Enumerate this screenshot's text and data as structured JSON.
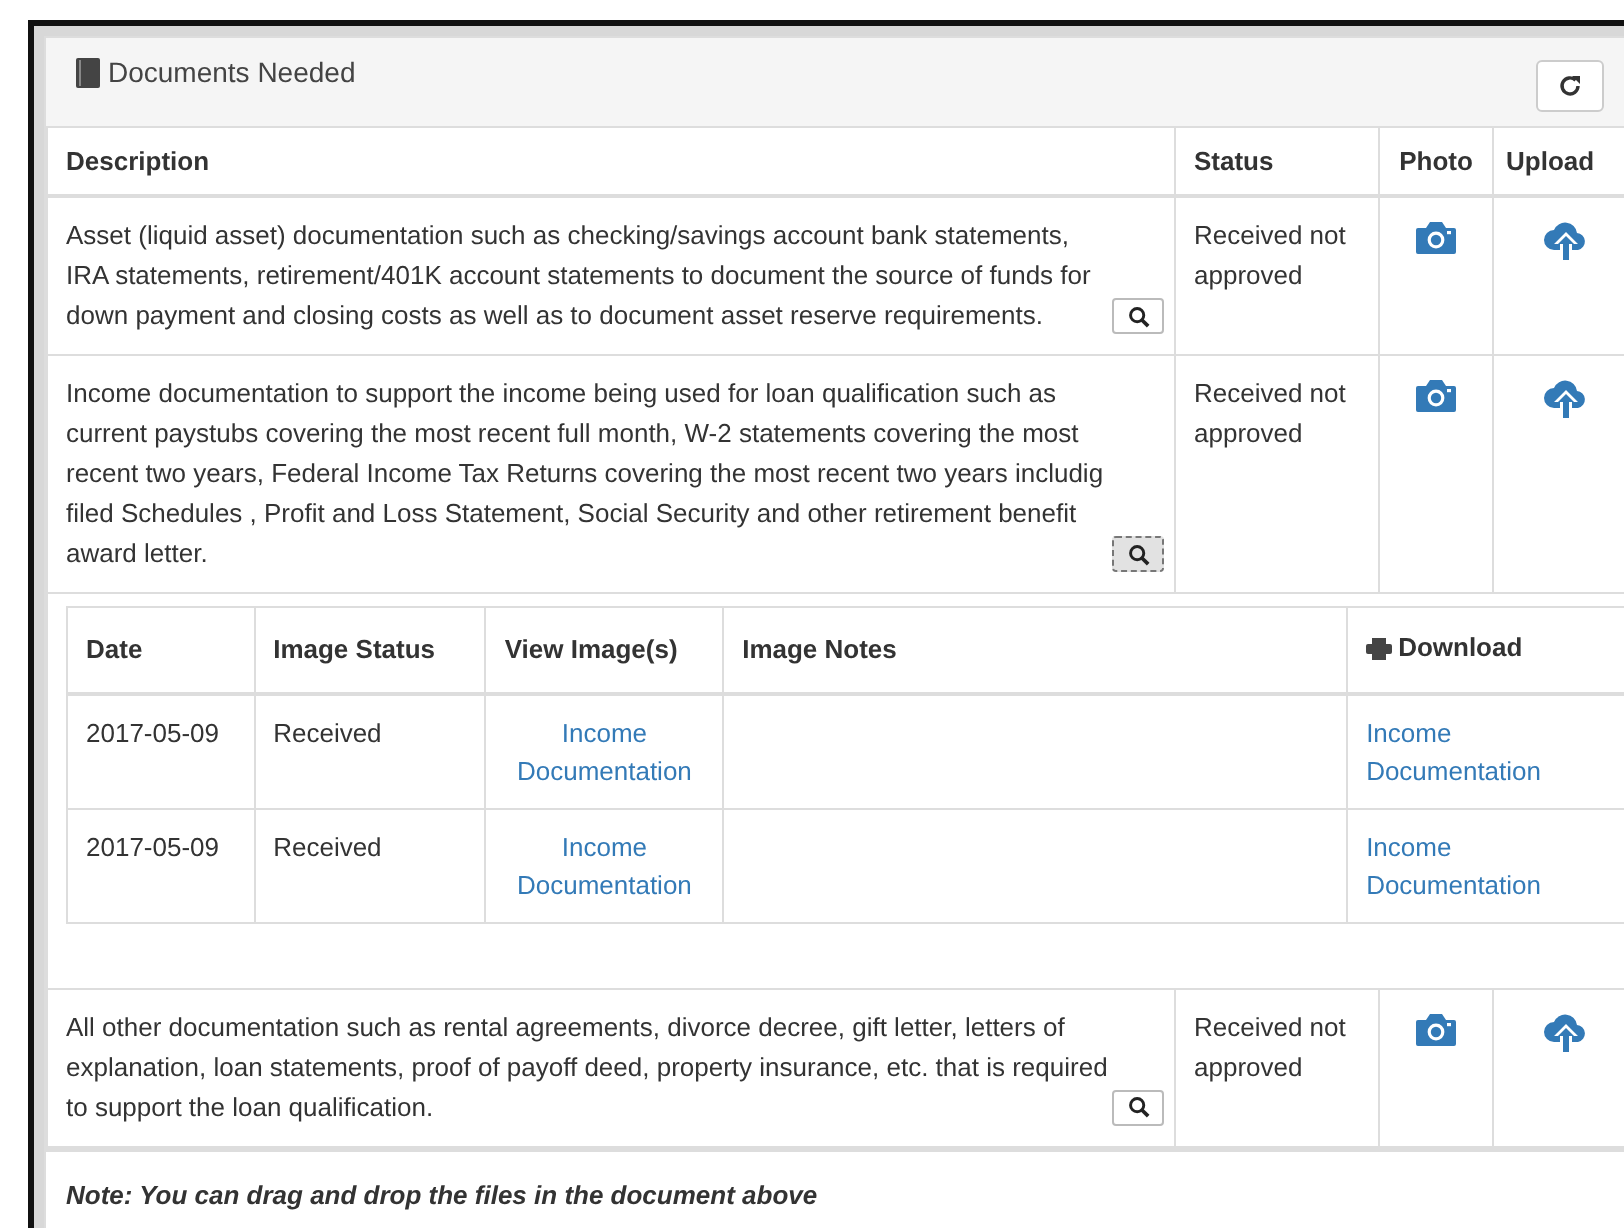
{
  "panel": {
    "title": "Documents Needed"
  },
  "table": {
    "columns": [
      "Description",
      "Status",
      "Photo",
      "Upload"
    ],
    "rows": [
      {
        "kind": "document",
        "description": "Asset (liquid asset) documentation such as checking/savings account bank statements, IRA statements, retirement/401K account statements to document the source of funds for down payment and closing costs as well as to document asset reserve requirements.",
        "status": "Received not approved",
        "focused": false
      },
      {
        "kind": "document",
        "description": "Income documentation to support the income being used for loan qualification such as current paystubs covering the most recent full month, W-2 statements covering the most recent two years, Federal Income Tax Returns covering the most recent two years includig filed Schedules , Profit and Loss Statement, Social Security and other retirement benefit award letter.",
        "status": "Received not approved",
        "focused": true
      },
      {
        "kind": "images",
        "columns": [
          "Date",
          "Image Status",
          "View Image(s)",
          "Image Notes",
          "Download"
        ],
        "rows": [
          {
            "date": "2017-05-09",
            "image_status": "Received",
            "view": "Income Documentation",
            "download": "Income Documentation"
          },
          {
            "date": "2017-05-09",
            "image_status": "Received",
            "view": "Income Documentation",
            "download": "Income Documentation"
          }
        ]
      },
      {
        "kind": "document",
        "description": "All other documentation such as rental agreements, divorce decree, gift letter, letters of explanation, loan statements, proof of payoff deed, property insurance, etc. that is required to support the loan qualification.",
        "status": "Received not approved",
        "focused": false
      }
    ]
  },
  "note": "Note: You can drag and drop the files in the document above"
}
